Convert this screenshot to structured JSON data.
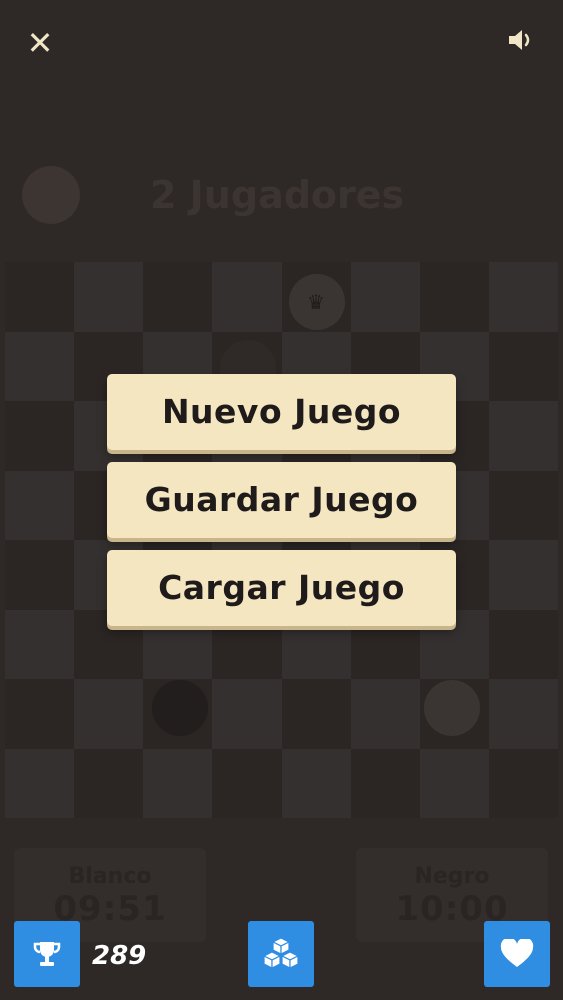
{
  "header": {
    "close_icon": "close-x-icon",
    "sound_icon": "speaker-icon"
  },
  "game": {
    "mode_title": "2 Jugadores",
    "white_label": "Blanco",
    "white_time": "09:51",
    "black_label": "Negro",
    "black_time": "10:00"
  },
  "menu": {
    "new_game": "Nuevo Juego",
    "save_game": "Guardar Juego",
    "load_game": "Cargar Juego"
  },
  "footer": {
    "score": "289",
    "trophy_icon": "trophy-icon",
    "cubes_icon": "cubes-icon",
    "heart_icon": "heart-icon"
  },
  "colors": {
    "overlay_bg": "#2e2826",
    "button_bg": "#f5e6c2",
    "accent_blue": "#2f8de2",
    "text_dark": "#1f1b1a"
  }
}
